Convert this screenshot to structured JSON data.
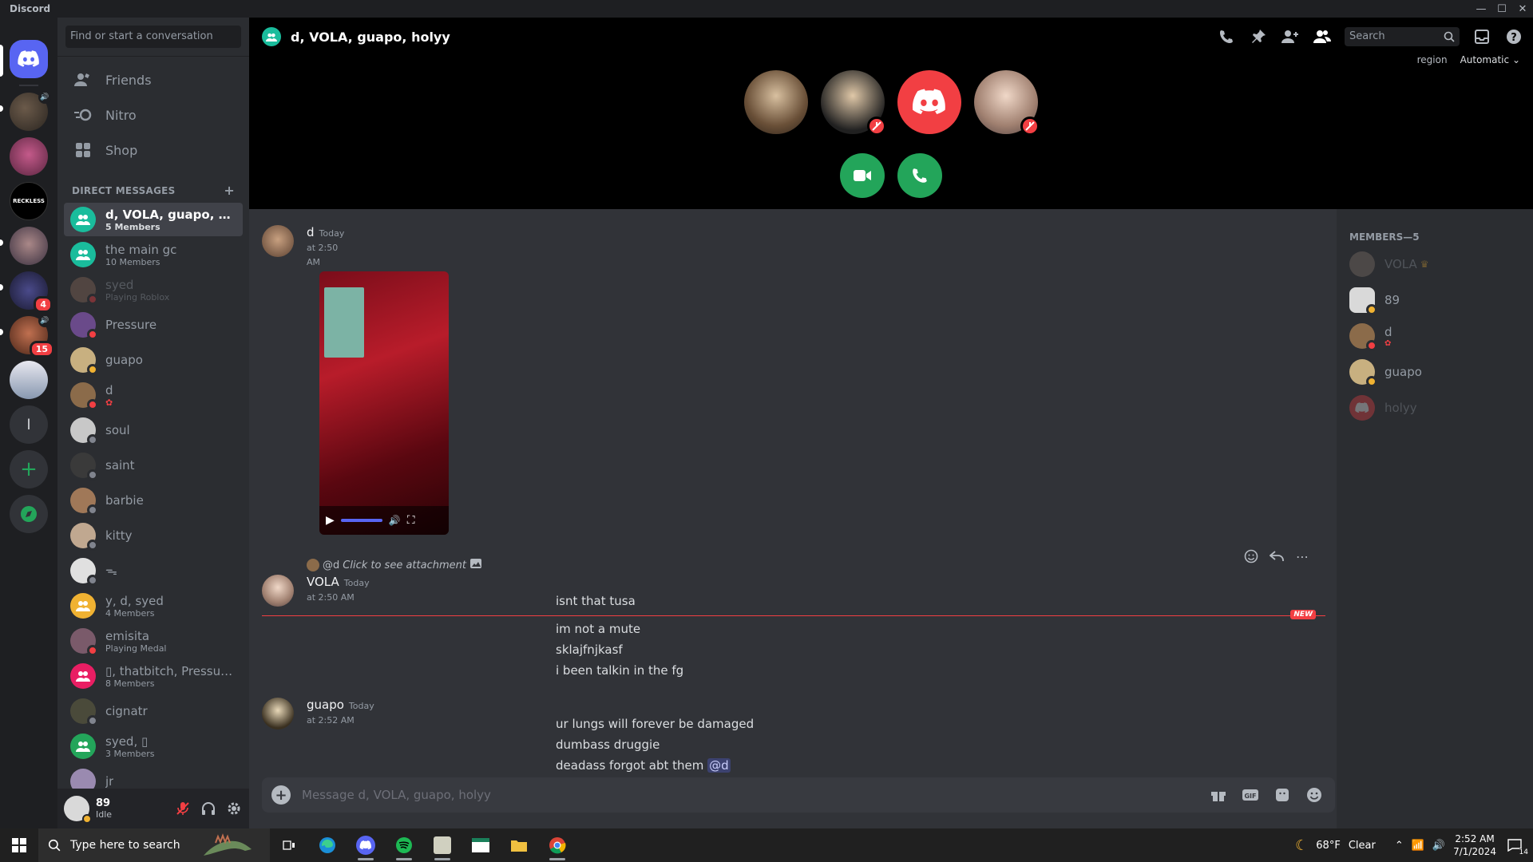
{
  "window": {
    "app_title": "Discord",
    "controls": [
      "—",
      "☐",
      "✕"
    ]
  },
  "guilds": {
    "badges": [
      "4",
      "15"
    ],
    "letter_server": "l"
  },
  "dms": {
    "search_placeholder": "Find or start a conversation",
    "nav": [
      {
        "label": "Friends",
        "icon": "friends-icon"
      },
      {
        "label": "Nitro",
        "icon": "nitro-icon"
      },
      {
        "label": "Shop",
        "icon": "shop-icon"
      }
    ],
    "header": "DIRECT MESSAGES",
    "list": [
      {
        "name": "d, VOLA, guapo, holyy",
        "sub": "5 Members",
        "group": true,
        "active": true
      },
      {
        "name": "the main gc",
        "sub": "10 Members",
        "group": true
      },
      {
        "name": "syed",
        "sub": "Playing Roblox",
        "dim": true
      },
      {
        "name": "Pressure",
        "sub": ""
      },
      {
        "name": "guapo",
        "sub": ""
      },
      {
        "name": "d",
        "sub": ""
      },
      {
        "name": "soul",
        "sub": ""
      },
      {
        "name": "saint",
        "sub": ""
      },
      {
        "name": "barbie",
        "sub": ""
      },
      {
        "name": "kitty",
        "sub": ""
      },
      {
        "name": "ᯓ",
        "sub": ""
      },
      {
        "name": "y, d, syed",
        "sub": "4 Members",
        "group": true
      },
      {
        "name": "emisita",
        "sub": "Playing Medal"
      },
      {
        "name": "▯, thatbitch, Pressure...",
        "sub": "8 Members",
        "group": true
      },
      {
        "name": "cignatr",
        "sub": ""
      },
      {
        "name": "syed, ▯",
        "sub": "3 Members",
        "group": true
      },
      {
        "name": "jr",
        "sub": ""
      }
    ]
  },
  "user_panel": {
    "name": "89",
    "status": "Idle"
  },
  "channel": {
    "title": "d, VOLA, guapo, holyy",
    "search_placeholder": "Search",
    "region_label": "region",
    "region_value": "Automatic"
  },
  "messages": {
    "msg1": {
      "author": "d",
      "timestamp": "Today at 2:50 AM"
    },
    "reply": {
      "author": "@d",
      "text": "Click to see attachment"
    },
    "msg2": {
      "author": "VOLA",
      "timestamp": "Today at 2:50 AM",
      "line1": "isnt that tusa"
    },
    "new_label": "NEW",
    "followups": [
      "im not a mute",
      "sklajfnjkasf",
      "i been talkin in the fg"
    ],
    "msg3": {
      "author": "guapo",
      "timestamp": "Today at 2:52 AM",
      "line1": "ur lungs will forever be damaged",
      "line2": "dumbass druggie",
      "line3": "deadass forgot abt them",
      "mention": "@d"
    }
  },
  "composer": {
    "placeholder": "Message d, VOLA, guapo, holyy"
  },
  "members": {
    "header": "MEMBERS—5",
    "list": [
      {
        "name": "VOLA",
        "owner": true,
        "dim": true
      },
      {
        "name": "89"
      },
      {
        "name": "d"
      },
      {
        "name": "guapo"
      },
      {
        "name": "holyy",
        "dim": true
      }
    ]
  },
  "taskbar": {
    "search_placeholder": "Type here to search",
    "weather_temp": "68°F",
    "weather_text": "Clear",
    "time": "2:52 AM",
    "date": "7/1/2024",
    "notif_count": "14"
  },
  "colors": {
    "blurple": "#5865f2",
    "green": "#23a55a",
    "red": "#f23f43",
    "teal": "#1abc9c"
  }
}
